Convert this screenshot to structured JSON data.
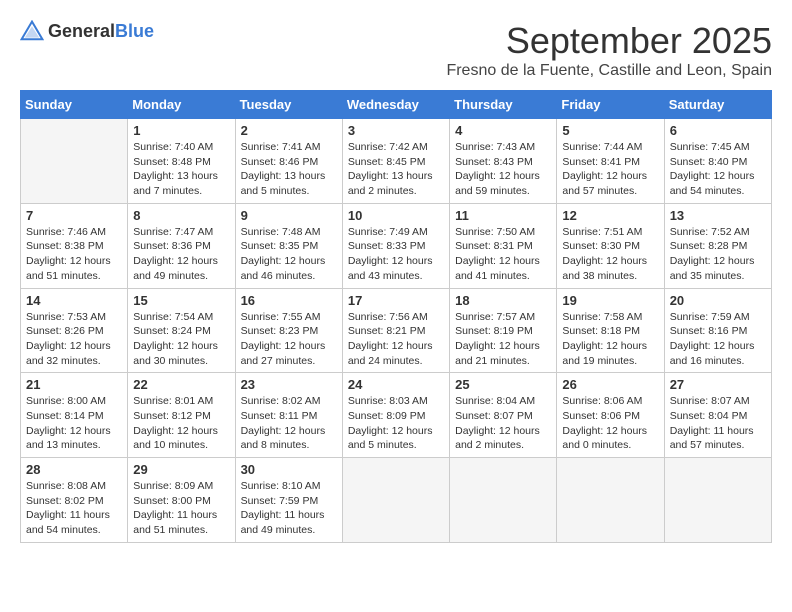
{
  "header": {
    "logo_general": "General",
    "logo_blue": "Blue",
    "month_title": "September 2025",
    "location": "Fresno de la Fuente, Castille and Leon, Spain"
  },
  "weekdays": [
    "Sunday",
    "Monday",
    "Tuesday",
    "Wednesday",
    "Thursday",
    "Friday",
    "Saturday"
  ],
  "weeks": [
    [
      {
        "day": "",
        "info": ""
      },
      {
        "day": "1",
        "info": "Sunrise: 7:40 AM\nSunset: 8:48 PM\nDaylight: 13 hours\nand 7 minutes."
      },
      {
        "day": "2",
        "info": "Sunrise: 7:41 AM\nSunset: 8:46 PM\nDaylight: 13 hours\nand 5 minutes."
      },
      {
        "day": "3",
        "info": "Sunrise: 7:42 AM\nSunset: 8:45 PM\nDaylight: 13 hours\nand 2 minutes."
      },
      {
        "day": "4",
        "info": "Sunrise: 7:43 AM\nSunset: 8:43 PM\nDaylight: 12 hours\nand 59 minutes."
      },
      {
        "day": "5",
        "info": "Sunrise: 7:44 AM\nSunset: 8:41 PM\nDaylight: 12 hours\nand 57 minutes."
      },
      {
        "day": "6",
        "info": "Sunrise: 7:45 AM\nSunset: 8:40 PM\nDaylight: 12 hours\nand 54 minutes."
      }
    ],
    [
      {
        "day": "7",
        "info": "Sunrise: 7:46 AM\nSunset: 8:38 PM\nDaylight: 12 hours\nand 51 minutes."
      },
      {
        "day": "8",
        "info": "Sunrise: 7:47 AM\nSunset: 8:36 PM\nDaylight: 12 hours\nand 49 minutes."
      },
      {
        "day": "9",
        "info": "Sunrise: 7:48 AM\nSunset: 8:35 PM\nDaylight: 12 hours\nand 46 minutes."
      },
      {
        "day": "10",
        "info": "Sunrise: 7:49 AM\nSunset: 8:33 PM\nDaylight: 12 hours\nand 43 minutes."
      },
      {
        "day": "11",
        "info": "Sunrise: 7:50 AM\nSunset: 8:31 PM\nDaylight: 12 hours\nand 41 minutes."
      },
      {
        "day": "12",
        "info": "Sunrise: 7:51 AM\nSunset: 8:30 PM\nDaylight: 12 hours\nand 38 minutes."
      },
      {
        "day": "13",
        "info": "Sunrise: 7:52 AM\nSunset: 8:28 PM\nDaylight: 12 hours\nand 35 minutes."
      }
    ],
    [
      {
        "day": "14",
        "info": "Sunrise: 7:53 AM\nSunset: 8:26 PM\nDaylight: 12 hours\nand 32 minutes."
      },
      {
        "day": "15",
        "info": "Sunrise: 7:54 AM\nSunset: 8:24 PM\nDaylight: 12 hours\nand 30 minutes."
      },
      {
        "day": "16",
        "info": "Sunrise: 7:55 AM\nSunset: 8:23 PM\nDaylight: 12 hours\nand 27 minutes."
      },
      {
        "day": "17",
        "info": "Sunrise: 7:56 AM\nSunset: 8:21 PM\nDaylight: 12 hours\nand 24 minutes."
      },
      {
        "day": "18",
        "info": "Sunrise: 7:57 AM\nSunset: 8:19 PM\nDaylight: 12 hours\nand 21 minutes."
      },
      {
        "day": "19",
        "info": "Sunrise: 7:58 AM\nSunset: 8:18 PM\nDaylight: 12 hours\nand 19 minutes."
      },
      {
        "day": "20",
        "info": "Sunrise: 7:59 AM\nSunset: 8:16 PM\nDaylight: 12 hours\nand 16 minutes."
      }
    ],
    [
      {
        "day": "21",
        "info": "Sunrise: 8:00 AM\nSunset: 8:14 PM\nDaylight: 12 hours\nand 13 minutes."
      },
      {
        "day": "22",
        "info": "Sunrise: 8:01 AM\nSunset: 8:12 PM\nDaylight: 12 hours\nand 10 minutes."
      },
      {
        "day": "23",
        "info": "Sunrise: 8:02 AM\nSunset: 8:11 PM\nDaylight: 12 hours\nand 8 minutes."
      },
      {
        "day": "24",
        "info": "Sunrise: 8:03 AM\nSunset: 8:09 PM\nDaylight: 12 hours\nand 5 minutes."
      },
      {
        "day": "25",
        "info": "Sunrise: 8:04 AM\nSunset: 8:07 PM\nDaylight: 12 hours\nand 2 minutes."
      },
      {
        "day": "26",
        "info": "Sunrise: 8:06 AM\nSunset: 8:06 PM\nDaylight: 12 hours\nand 0 minutes."
      },
      {
        "day": "27",
        "info": "Sunrise: 8:07 AM\nSunset: 8:04 PM\nDaylight: 11 hours\nand 57 minutes."
      }
    ],
    [
      {
        "day": "28",
        "info": "Sunrise: 8:08 AM\nSunset: 8:02 PM\nDaylight: 11 hours\nand 54 minutes."
      },
      {
        "day": "29",
        "info": "Sunrise: 8:09 AM\nSunset: 8:00 PM\nDaylight: 11 hours\nand 51 minutes."
      },
      {
        "day": "30",
        "info": "Sunrise: 8:10 AM\nSunset: 7:59 PM\nDaylight: 11 hours\nand 49 minutes."
      },
      {
        "day": "",
        "info": ""
      },
      {
        "day": "",
        "info": ""
      },
      {
        "day": "",
        "info": ""
      },
      {
        "day": "",
        "info": ""
      }
    ]
  ]
}
